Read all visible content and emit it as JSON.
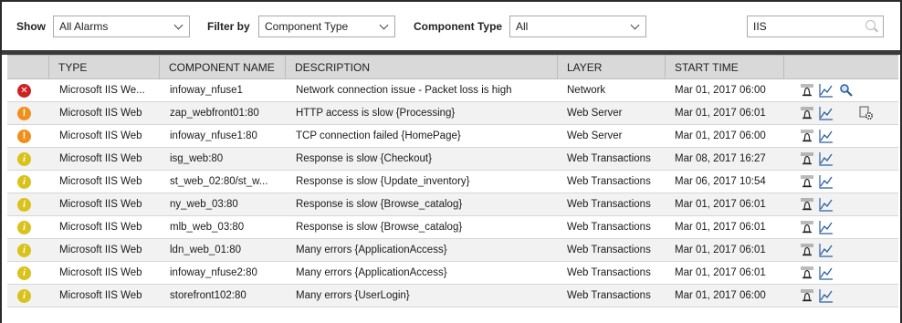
{
  "filters": {
    "show_label": "Show",
    "show_value": "All Alarms",
    "filter_label": "Filter by",
    "filter_value": "Component Type",
    "comptype_label": "Component Type",
    "comptype_value": "All",
    "search_value": "IIS"
  },
  "table": {
    "headers": [
      "TYPE",
      "COMPONENT NAME",
      "DESCRIPTION",
      "LAYER",
      "START TIME"
    ],
    "rows": [
      {
        "severity": "critical",
        "type": "Microsoft IIS We...",
        "component": "infoway_nfuse1",
        "description": "Network connection issue - Packet loss is high",
        "layer": "Network",
        "start": "Mar 01, 2017 06:00",
        "extra": "magnifier"
      },
      {
        "severity": "major",
        "type": "Microsoft IIS Web",
        "component": "zap_webfront01:80",
        "description": "HTTP access is slow {Processing}",
        "layer": "Web Server",
        "start": "Mar 01, 2017 06:01",
        "extra": "settings"
      },
      {
        "severity": "major",
        "type": "Microsoft IIS Web",
        "component": "infoway_nfuse1:80",
        "description": "TCP connection failed {HomePage}",
        "layer": "Web Server",
        "start": "Mar 01, 2017 06:00",
        "extra": ""
      },
      {
        "severity": "minor",
        "type": "Microsoft IIS Web",
        "component": "isg_web:80",
        "description": "Response is slow {Checkout}",
        "layer": "Web Transactions",
        "start": "Mar 08, 2017 16:27",
        "extra": ""
      },
      {
        "severity": "minor",
        "type": "Microsoft IIS Web",
        "component": "st_web_02:80/st_w...",
        "description": "Response is slow {Update_inventory}",
        "layer": "Web Transactions",
        "start": "Mar 06, 2017 10:54",
        "extra": ""
      },
      {
        "severity": "minor",
        "type": "Microsoft IIS Web",
        "component": "ny_web_03:80",
        "description": "Response is slow {Browse_catalog}",
        "layer": "Web Transactions",
        "start": "Mar 01, 2017 06:01",
        "extra": ""
      },
      {
        "severity": "minor",
        "type": "Microsoft IIS Web",
        "component": "mlb_web_03:80",
        "description": "Response is slow {Browse_catalog}",
        "layer": "Web Transactions",
        "start": "Mar 01, 2017 06:01",
        "extra": ""
      },
      {
        "severity": "minor",
        "type": "Microsoft IIS Web",
        "component": "ldn_web_01:80",
        "description": "Many errors {ApplicationAccess}",
        "layer": "Web Transactions",
        "start": "Mar 01, 2017 06:01",
        "extra": ""
      },
      {
        "severity": "minor",
        "type": "Microsoft IIS Web",
        "component": "infoway_nfuse2:80",
        "description": "Many errors {ApplicationAccess}",
        "layer": "Web Transactions",
        "start": "Mar 01, 2017 06:01",
        "extra": ""
      },
      {
        "severity": "minor",
        "type": "Microsoft IIS Web",
        "component": "storefront102:80",
        "description": "Many errors {UserLogin}",
        "layer": "Web Transactions",
        "start": "Mar 01, 2017 06:00",
        "extra": ""
      }
    ]
  },
  "colors": {
    "critical": "#cc2222",
    "major": "#f0901c",
    "minor": "#d9c21a",
    "header_bg": "#d9d9d9",
    "alt_row": "#f2f2f2"
  },
  "icons": {
    "critical": "x-circle-icon",
    "major": "exclamation-circle-icon",
    "minor": "info-circle-icon",
    "bell": "alarm-bell-icon",
    "graph": "line-graph-icon",
    "magnifier": "magnifier-icon",
    "settings": "settings-gear-icon"
  }
}
